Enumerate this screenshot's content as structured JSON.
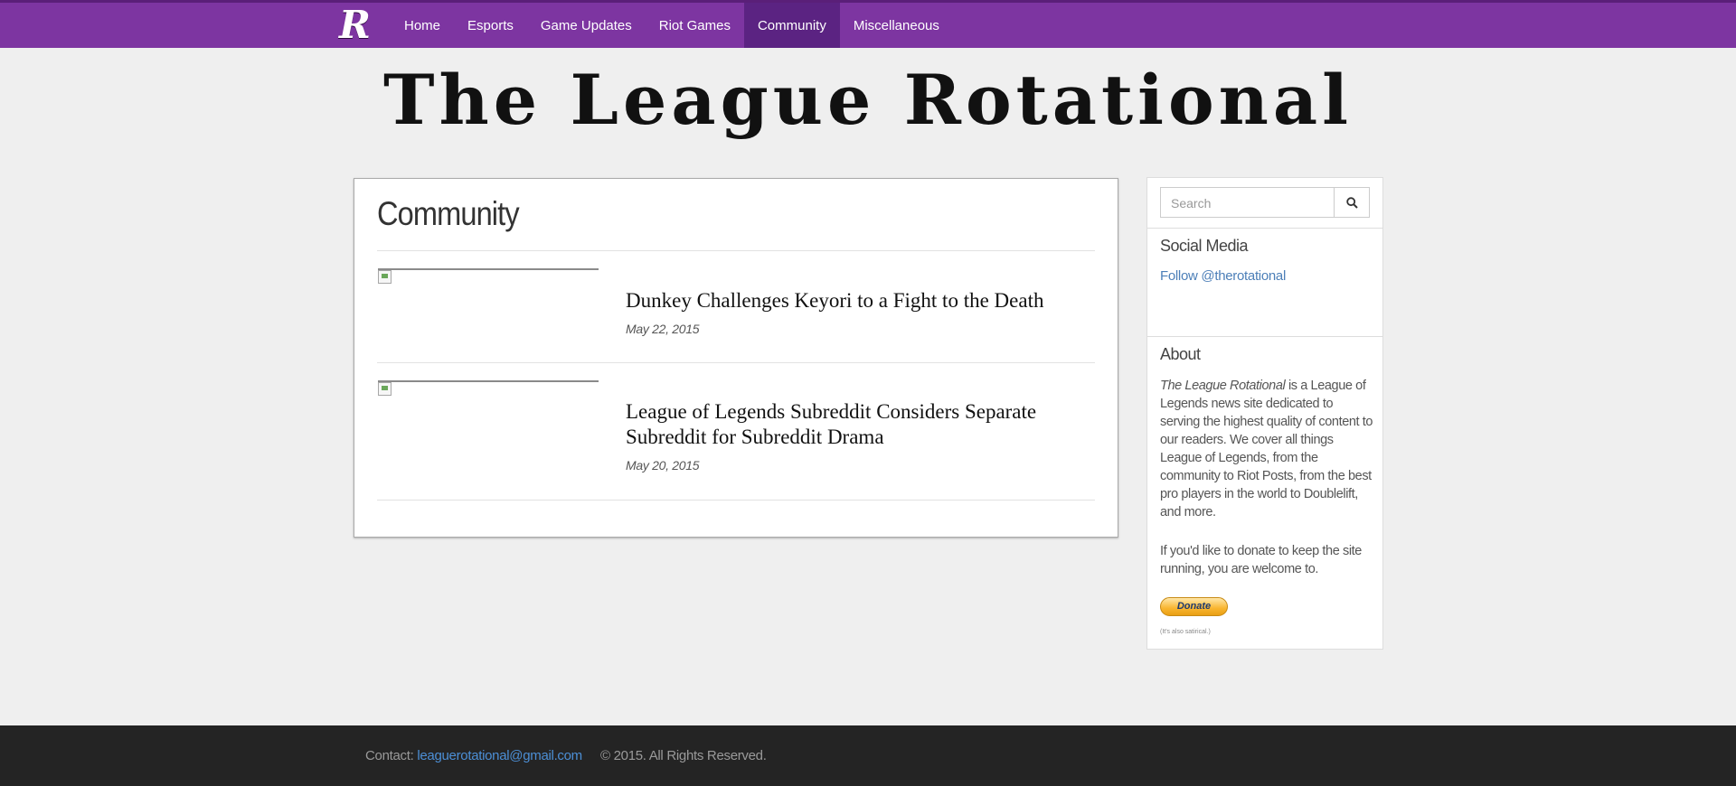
{
  "nav": {
    "brand": "R",
    "items": [
      {
        "label": "Home",
        "active": false
      },
      {
        "label": "Esports",
        "active": false
      },
      {
        "label": "Game Updates",
        "active": false
      },
      {
        "label": "Riot Games",
        "active": false
      },
      {
        "label": "Community",
        "active": true
      },
      {
        "label": "Miscellaneous",
        "active": false
      }
    ],
    "color": "#7d35a1",
    "active_color": "#5b2382"
  },
  "masthead": "The League Rotational",
  "main": {
    "title": "Community",
    "articles": [
      {
        "title": "Dunkey Challenges Keyori to a Fight to the Death",
        "date": "May 22, 2015"
      },
      {
        "title": "League of Legends Subreddit Considers Separate Subreddit for Subreddit Drama",
        "date": "May 20, 2015"
      }
    ]
  },
  "sidebar": {
    "search_placeholder": "Search",
    "search_icon": "search-icon",
    "social_heading": "Social Media",
    "follow_link": "Follow @therotational",
    "about_heading": "About",
    "about_site_name": "The League Rotational",
    "about_body": " is a League of Legends news site dedicated to serving the highest quality of content to our readers. We cover all things League of Legends, from the community to Riot Posts, from the best pro players in the world to Doublelift, and more.",
    "donate_text": "If you'd like to donate to keep the site running, you are welcome to.",
    "donate_button": "Donate",
    "tiny_note": "(It's also satirical.)"
  },
  "footer": {
    "contact_label": "Contact: ",
    "contact_email": "leaguerotational@gmail.com",
    "copyright": "© 2015. All Rights Reserved."
  }
}
